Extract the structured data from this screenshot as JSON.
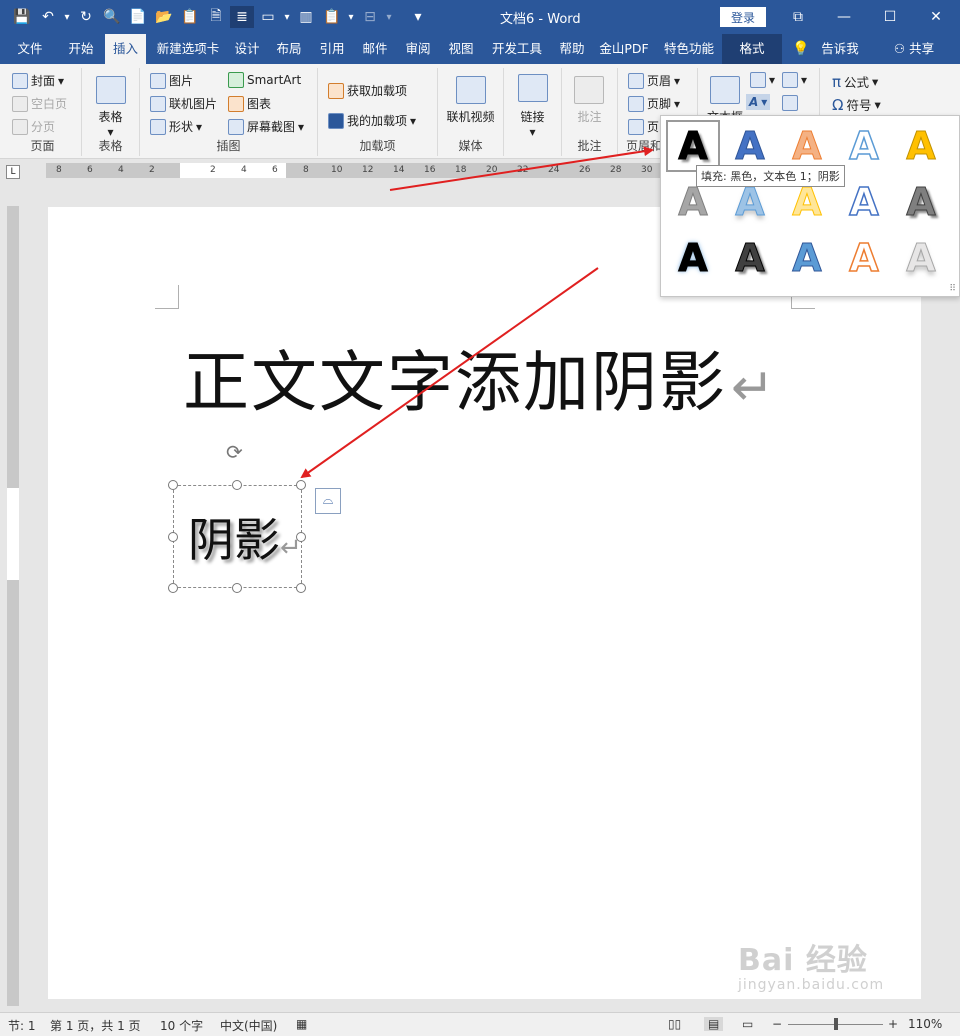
{
  "titlebar": {
    "qat": [
      "💾",
      "↶",
      "▾",
      "↻",
      "🔍",
      "📄",
      "📂",
      "📋",
      "🗎",
      "≣",
      "▭",
      "▾",
      "▥",
      "📋",
      "▾",
      "⊟",
      "▾",
      "▾"
    ],
    "doc_title": "文档6 - Word",
    "login": "登录",
    "ribbon_display": "⧉",
    "minimize": "—",
    "maximize": "☐",
    "close": "✕"
  },
  "tabs": {
    "file": "文件",
    "home": "开始",
    "insert": "插入",
    "newtab": "新建选项卡",
    "design": "设计",
    "layout": "布局",
    "references": "引用",
    "mailings": "邮件",
    "review": "审阅",
    "view": "视图",
    "developer": "开发工具",
    "help": "帮助",
    "wps_pdf": "金山PDF",
    "features": "特色功能",
    "format": "格式",
    "tellme": "告诉我",
    "share": "共享"
  },
  "ribbon": {
    "pages": {
      "label": "页面",
      "cover": "封面",
      "blank": "空白页",
      "break": "分页"
    },
    "tables": {
      "label": "表格",
      "table": "表格"
    },
    "illustrations": {
      "label": "插图",
      "pictures": "图片",
      "online_pictures": "联机图片",
      "shapes": "形状",
      "smartart": "SmartArt",
      "chart": "图表",
      "screenshot": "屏幕截图"
    },
    "addins": {
      "label": "加载项",
      "get": "获取加载项",
      "mine": "我的加载项"
    },
    "media": {
      "label": "媒体",
      "online_video": "联机视频"
    },
    "links": {
      "label": "",
      "link": "链接"
    },
    "comments": {
      "label": "批注",
      "comment": "批注"
    },
    "header_footer": {
      "label": "页眉和",
      "header": "页眉",
      "footer": "页脚",
      "page_number": "页"
    },
    "text": {
      "textbox": "文本框"
    },
    "symbols": {
      "equation": "公式",
      "symbol": "符号"
    }
  },
  "ruler": {
    "corner": "L",
    "ticks": [
      "8",
      "6",
      "4",
      "2",
      "2",
      "4",
      "6",
      "8",
      "10",
      "12",
      "14",
      "16",
      "18",
      "20",
      "22",
      "24",
      "26",
      "28",
      "30"
    ]
  },
  "document": {
    "body_text": "正文文字添加阴影",
    "para_mark": "↵",
    "textbox_text": "阴影",
    "textbox_mark": "↵",
    "rotate": "⟳",
    "layout_options": "⌓"
  },
  "gallery": {
    "items": [
      {
        "glyph": "A",
        "fill": "#000000",
        "stroke": "#000000",
        "style": "shadow"
      },
      {
        "glyph": "A",
        "fill": "#4472c4",
        "stroke": "#2f5597",
        "style": "plain"
      },
      {
        "glyph": "A",
        "fill": "#f4b183",
        "stroke": "#ed7d31",
        "style": "plain"
      },
      {
        "glyph": "A",
        "fill": "#ffffff",
        "stroke": "#5b9bd5",
        "style": "outline"
      },
      {
        "glyph": "A",
        "fill": "#ffc000",
        "stroke": "#bf9000",
        "style": "plain"
      },
      {
        "glyph": "A",
        "fill": "#a6a6a6",
        "stroke": "#7f7f7f",
        "style": "plain"
      },
      {
        "glyph": "A",
        "fill": "#9dc3e6",
        "stroke": "#5b9bd5",
        "style": "reflection"
      },
      {
        "glyph": "A",
        "fill": "#ffe699",
        "stroke": "#ffc000",
        "style": "plain"
      },
      {
        "glyph": "A",
        "fill": "#ffffff",
        "stroke": "#4472c4",
        "style": "outline"
      },
      {
        "glyph": "A",
        "fill": "#7f7f7f",
        "stroke": "#404040",
        "style": "shadow"
      },
      {
        "glyph": "A",
        "fill": "#000000",
        "stroke": "#000000",
        "style": "glow"
      },
      {
        "glyph": "A",
        "fill": "#404040",
        "stroke": "#000000",
        "style": "shadow"
      },
      {
        "glyph": "A",
        "fill": "#5b9bd5",
        "stroke": "#2f5597",
        "style": "plain"
      },
      {
        "glyph": "A",
        "fill": "#ffffff",
        "stroke": "#ed7d31",
        "style": "outline"
      },
      {
        "glyph": "A",
        "fill": "#e7e6e6",
        "stroke": "#a6a6a6",
        "style": "reflection"
      }
    ],
    "tooltip": "填充: 黑色，文本色 1；阴影",
    "grip": "⠿"
  },
  "statusbar": {
    "section": "节: 1",
    "page": "第 1 页，共 1 页",
    "words": "10 个字",
    "language": "中文(中国)",
    "zoom": "110%",
    "zoom_minus": "−",
    "zoom_plus": "+"
  },
  "watermark": {
    "main": "Bai 经验",
    "sub": "jingyan.baidu.com"
  },
  "colors": {
    "accent": "#2b579a",
    "arrow": "#e02020"
  }
}
